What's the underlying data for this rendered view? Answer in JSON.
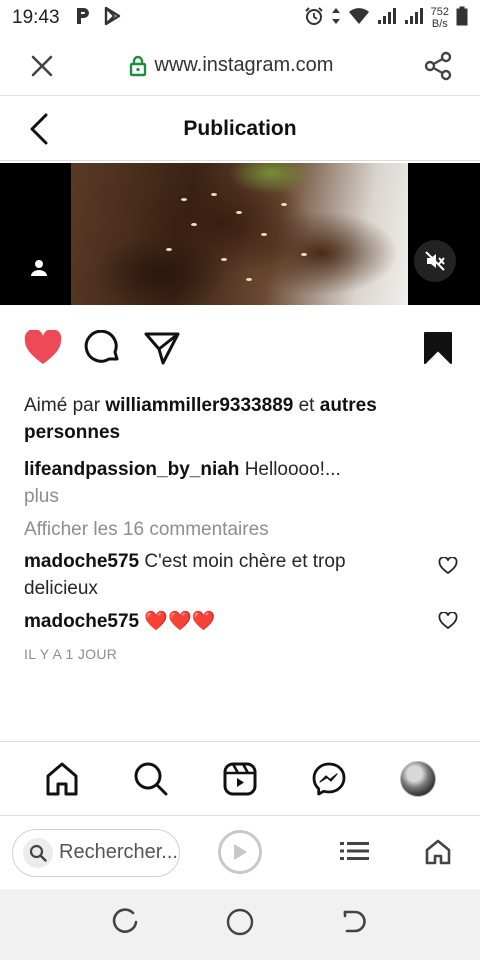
{
  "status_bar": {
    "time": "19:43",
    "net_speed_value": "752",
    "net_speed_unit": "B/s",
    "icons": [
      "parking-icon",
      "play-store-icon",
      "alarm-icon",
      "data-arrows-icon",
      "wifi-icon",
      "signal-icon",
      "signal-icon",
      "battery-icon"
    ]
  },
  "browser": {
    "url": "www.instagram.com",
    "close_icon": "close-icon",
    "lock_icon": "lock-icon",
    "share_icon": "share-icon"
  },
  "post_header": {
    "title": "Publication"
  },
  "media": {
    "description_icon_user": "user-tag-icon",
    "mute_icon": "muted-speaker-icon"
  },
  "actions": {
    "like_color": "#ed4956",
    "icons": [
      "heart-icon",
      "comment-icon",
      "send-icon",
      "bookmark-icon"
    ]
  },
  "likes": {
    "prefix": "Aimé par",
    "user": "williammiller9333889",
    "middle": "et",
    "suffix": "autres personnes"
  },
  "caption": {
    "user": "lifeandpassion_by_niah",
    "text": "Helloooo!...",
    "more": "plus"
  },
  "comments_link": "Afficher les 16 commentaires",
  "comments": [
    {
      "user": "madoche575",
      "text": "C'est moin chère et trop delicieux"
    },
    {
      "user": "madoche575",
      "text": "❤️❤️❤️"
    }
  ],
  "timestamp": "IL Y A 1 JOUR",
  "ig_nav": {
    "items": [
      "home-icon",
      "search-icon",
      "reels-icon",
      "messenger-icon",
      "profile-avatar"
    ]
  },
  "browser_bottom": {
    "search_placeholder": "Rechercher..."
  },
  "sys_nav": {
    "items": [
      "recent-apps-icon",
      "home-circle-icon",
      "back-icon"
    ]
  }
}
